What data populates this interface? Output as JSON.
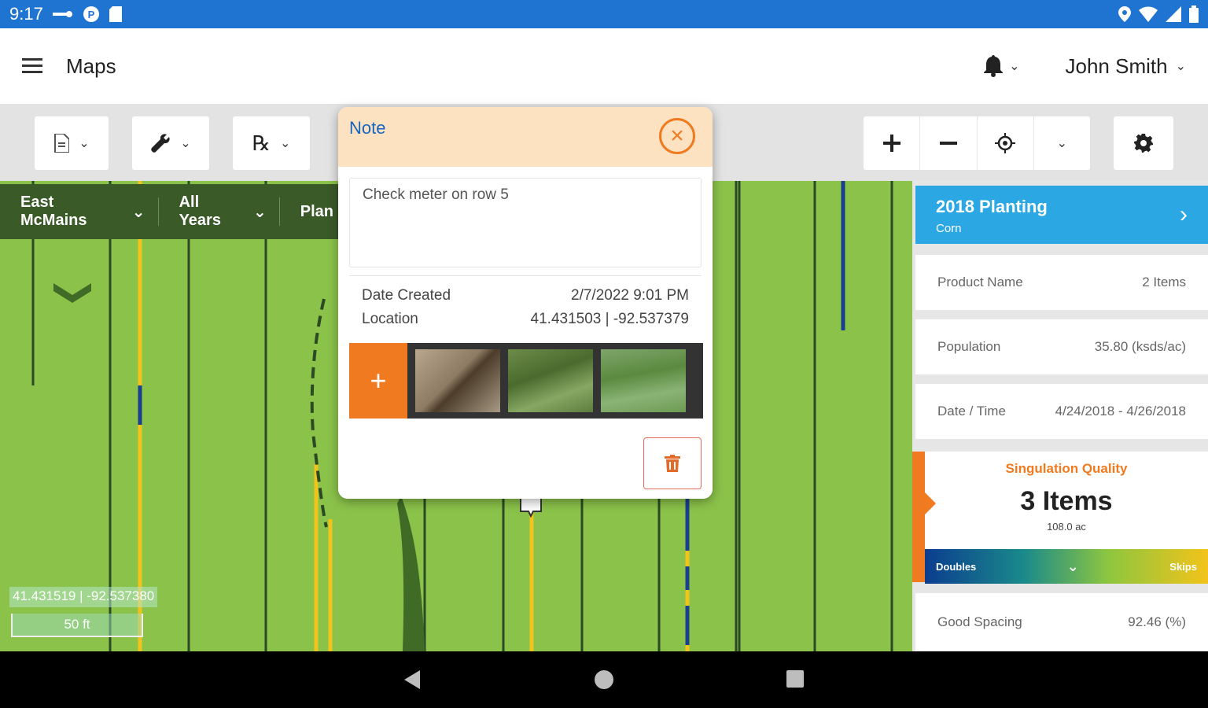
{
  "status_bar": {
    "time": "9:17"
  },
  "app_bar": {
    "title": "Maps",
    "user_name": "John Smith"
  },
  "map": {
    "filters": [
      {
        "label": "East McMains"
      },
      {
        "label": "All Years"
      },
      {
        "label": "Plan"
      }
    ],
    "coordinates": "41.431519 | -92.537380",
    "scale": "50 ft"
  },
  "note_dialog": {
    "title": "Note",
    "text": "Check meter on row 5",
    "date_created_label": "Date Created",
    "date_created_value": "2/7/2022 9:01 PM",
    "location_label": "Location",
    "location_value": "41.431503 | -92.537379",
    "add_photo_label": "+"
  },
  "panel": {
    "header_title": "2018 Planting",
    "header_subtitle": "Corn",
    "rows": [
      {
        "label": "Product Name",
        "value": "2 Items"
      },
      {
        "label": "Population",
        "value": "35.80 (ksds/ac)"
      },
      {
        "label": "Date / Time",
        "value": "4/24/2018 - 4/26/2018"
      }
    ],
    "singulation": {
      "label": "Singulation Quality",
      "value": "3 Items",
      "area": "108.0 ac",
      "legend_left": "Doubles",
      "legend_right": "Skips"
    },
    "good_spacing": {
      "label": "Good Spacing",
      "value": "92.46 (%)"
    }
  },
  "colors": {
    "status_bar": "#1f73d1",
    "accent_orange": "#f07a1f",
    "panel_header": "#2ba7e4",
    "map_green": "#8bc34a",
    "note_header": "#fde2c1"
  }
}
